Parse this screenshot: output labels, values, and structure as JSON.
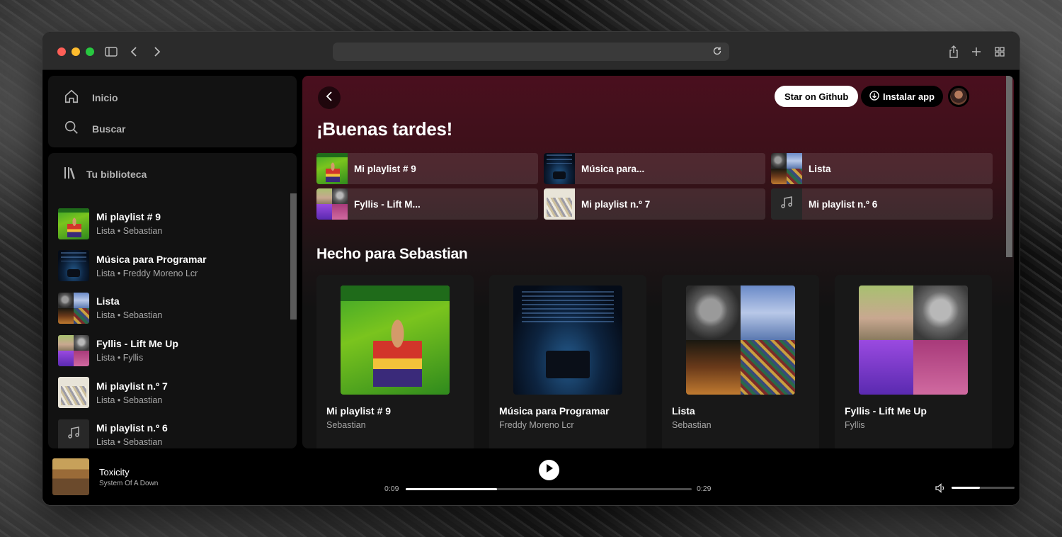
{
  "nav": {
    "home": "Inicio",
    "search": "Buscar"
  },
  "library": {
    "title": "Tu biblioteca",
    "items": [
      {
        "title": "Mi playlist # 9",
        "subtitle": "Lista • Sebastian",
        "art": "art-huay"
      },
      {
        "title": "Música para Programar",
        "subtitle": "Lista • Freddy Moreno Lcr",
        "art": "art-code"
      },
      {
        "title": "Lista",
        "subtitle": "Lista • Sebastian",
        "art": "art-lista"
      },
      {
        "title": "Fyllis - Lift Me Up",
        "subtitle": "Lista • Fyllis",
        "art": "art-fyllis"
      },
      {
        "title": "Mi playlist n.º 7",
        "subtitle": "Lista • Sebastian",
        "art": "art-p7"
      },
      {
        "title": "Mi playlist n.º 6",
        "subtitle": "Lista • Sebastian",
        "art": "art-note"
      }
    ]
  },
  "header": {
    "star_label": "Star on Github",
    "install_label": "Instalar app"
  },
  "greeting": "¡Buenas tardes!",
  "quick": [
    {
      "label": "Mi playlist # 9",
      "art": "art-huay"
    },
    {
      "label": "Música para...",
      "art": "art-code"
    },
    {
      "label": "Lista",
      "art": "art-lista"
    },
    {
      "label": "Fyllis - Lift M...",
      "art": "art-fyllis"
    },
    {
      "label": "Mi playlist n.º 7",
      "art": "art-p7"
    },
    {
      "label": "Mi playlist n.º 6",
      "art": "art-note"
    }
  ],
  "section": {
    "title": "Hecho para Sebastian",
    "cards": [
      {
        "title": "Mi playlist # 9",
        "subtitle": "Sebastian",
        "art": "art-huay"
      },
      {
        "title": "Música para Programar",
        "subtitle": "Freddy Moreno Lcr",
        "art": "art-code"
      },
      {
        "title": "Lista",
        "subtitle": "Sebastian",
        "art": "art-lista"
      },
      {
        "title": "Fyllis - Lift Me Up",
        "subtitle": "Fyllis",
        "art": "art-fyllis"
      }
    ]
  },
  "player": {
    "title": "Toxicity",
    "artist": "System Of A Down",
    "elapsed": "0:09",
    "duration": "0:29",
    "progress": 0.32,
    "volume": 0.45
  },
  "icons": {
    "home": "home-icon",
    "search": "search-icon",
    "library": "library-icon",
    "back": "chevron-left-icon",
    "download": "download-icon",
    "play": "play-icon",
    "volume": "volume-icon",
    "note": "music-note-icon"
  }
}
